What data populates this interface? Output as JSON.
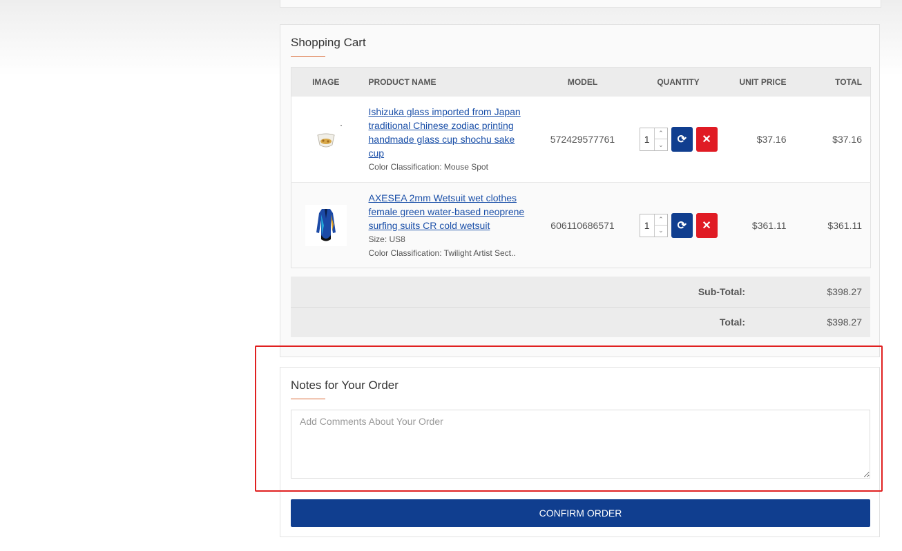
{
  "cart": {
    "title": "Shopping Cart",
    "columns": [
      "Image",
      "Product Name",
      "Model",
      "Quantity",
      "Unit Price",
      "Total"
    ],
    "items": [
      {
        "name": "Ishizuka glass imported from Japan traditional Chinese zodiac printing handmade glass cup shochu sake cup",
        "options": [
          "Color Classification: Mouse Spot"
        ],
        "model": "572429577761",
        "quantity": "1",
        "unit_price": "$37.16",
        "total": "$37.16",
        "thumb_icon": "glass-cup-icon"
      },
      {
        "name": "AXESEA 2mm Wetsuit wet clothes female green water-based neoprene surfing suits CR cold wetsuit",
        "options": [
          "Size: US8",
          "Color Classification: Twilight Artist Sect.."
        ],
        "model": "606110686571",
        "quantity": "1",
        "unit_price": "$361.11",
        "total": "$361.11",
        "thumb_icon": "wetsuit-icon"
      }
    ],
    "subtotal_label": "Sub-Total:",
    "subtotal_value": "$398.27",
    "total_label": "Total:",
    "total_value": "$398.27"
  },
  "notes": {
    "title": "Notes for Your Order",
    "placeholder": "Add Comments About Your Order"
  },
  "confirm_label": "CONFIRM ORDER",
  "colors": {
    "accent_underline": "#d9642f",
    "primary_button": "#103e8f",
    "remove_button": "#e01b24",
    "link": "#1a4fa8",
    "highlight": "#e02020"
  }
}
